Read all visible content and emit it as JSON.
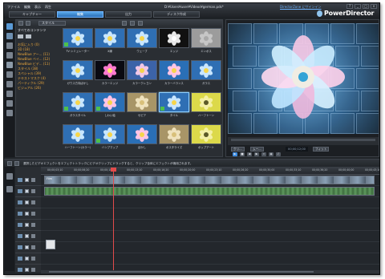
{
  "app": {
    "menu": [
      "ファイル",
      "編集",
      "表示",
      "再生"
    ],
    "file_path": "D:¥Users¥user¥Videos¥german.pds*",
    "directorzone_link": "DirectorZone にサインイン",
    "logo": "PowerDirector",
    "window_buttons": [
      "?",
      "_",
      "□",
      "×"
    ]
  },
  "modes": {
    "tabs": [
      "キャプチャー",
      "編集",
      "出力",
      "ディスク作成"
    ],
    "active_index": 1
  },
  "library": {
    "style_label": "スタイル",
    "all_content": "すべてのコンテンツ",
    "categories": [
      "お気に入り (0)",
      "3D (18)",
      "NewBlue アー... (11)",
      "NewBlue ベイ... (12)",
      "NewBlue ビデ... (11)",
      "スタイル (38)",
      "スペシャル (39)",
      "テキストマスク (4)",
      "パーティクル (29)",
      "ビジュアル (26)"
    ],
    "effects": [
      {
        "label": "TV シミュレーター",
        "style": "blue",
        "badge": true
      },
      {
        "label": "X線",
        "style": "blue",
        "badge": false
      },
      {
        "label": "ウェーブ",
        "style": "blue",
        "badge": false
      },
      {
        "label": "エッジ",
        "style": "edge",
        "badge": false
      },
      {
        "label": "エンボス",
        "style": "emboss",
        "badge": false
      },
      {
        "label": "ガウス方向ぼかし",
        "style": "blue",
        "badge": false
      },
      {
        "label": "カラーエッジ",
        "style": "coloredge",
        "badge": false
      },
      {
        "label": "カラークレヨン",
        "style": "crayon",
        "badge": false
      },
      {
        "label": "カラーバランス",
        "style": "pink",
        "badge": false
      },
      {
        "label": "ガラス",
        "style": "blue",
        "badge": false
      },
      {
        "label": "ガラスタイル",
        "style": "blue",
        "badge": true
      },
      {
        "label": "しわい絵",
        "style": "pink",
        "badge": true
      },
      {
        "label": "セピア",
        "style": "sepia",
        "badge": false
      },
      {
        "label": "タイル",
        "style": "blue",
        "badge": true
      },
      {
        "label": "ハーフトーン",
        "style": "halftone",
        "badge": false
      },
      {
        "label": "ハーフトーン(カラー)",
        "style": "blue",
        "badge": false
      },
      {
        "label": "バンプマップ",
        "style": "blue",
        "badge": true
      },
      {
        "label": "ぼかし",
        "style": "pink",
        "badge": false
      },
      {
        "label": "ポスタライズ",
        "style": "sepia",
        "badge": false
      },
      {
        "label": "ポップアート",
        "style": "halftone",
        "badge": false
      }
    ],
    "selected_index": 13
  },
  "preview": {
    "mode_labels": [
      "クリ...",
      "ムー..."
    ],
    "timecode": "00;00;12;00",
    "fit_label": "フィット"
  },
  "timeline": {
    "message": "選択したビデオエフェクトをエフェクトトラックにビデオクリップにドラッグすると、クリップ全体にエフェクトが適用されます。",
    "ruler_ticks": [
      "00;00;03;10",
      "00;00;06;20",
      "00;00;10;00",
      "00;00;13;10",
      "00;00;16;20",
      "00;00;20;00",
      "00;00;23;10",
      "00;00;26;20",
      "00;00;30;00",
      "00;00;33;10",
      "00;00;36;20",
      "00;00;40;00",
      "00;00;43;10"
    ],
    "clip_label": "Film"
  },
  "colors": {
    "accent": "#3a8ae0",
    "category_text": "#e5a43c",
    "playhead": "#e14b4b"
  }
}
